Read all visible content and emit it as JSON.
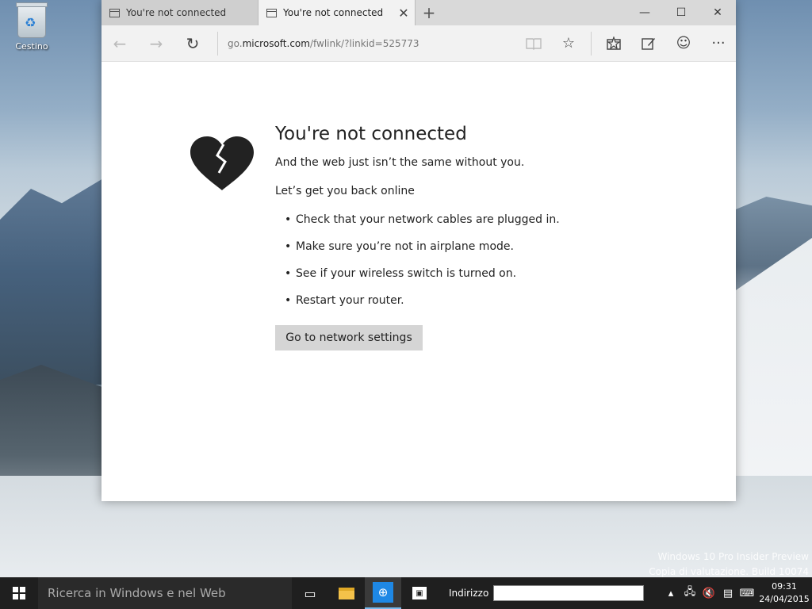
{
  "desktop": {
    "recycle_bin_label": "Cestino",
    "watermark_line1": "Windows 10 Pro Insider Preview",
    "watermark_line2": "Copia di valutazione. Build 10074"
  },
  "browser": {
    "tabs": [
      {
        "title": "You're not connected",
        "active": false
      },
      {
        "title": "You're not connected",
        "active": true
      }
    ],
    "new_tab_glyph": "+",
    "window_controls": {
      "minimize": "—",
      "maximize": "☐",
      "close": "✕"
    },
    "address": {
      "prefix": "go.",
      "host": "microsoft.com",
      "path": "/fwlink/?linkid=525773"
    }
  },
  "page": {
    "title": "You're not connected",
    "subtitle": "And the web just isn’t the same without you.",
    "prompt": "Let’s get you back online",
    "tips": [
      "Check that your network cables are plugged in.",
      "Make sure you’re not in airplane mode.",
      "See if your wireless switch is turned on.",
      "Restart your router."
    ],
    "button_label": "Go to network settings"
  },
  "taskbar": {
    "search_placeholder": "Ricerca in Windows e nel Web",
    "address_label": "Indirizzo",
    "address_value": "",
    "time": "09:31",
    "date": "24/04/2015"
  },
  "colors": {
    "taskbar_bg": "#1f1f1f",
    "edge_blue": "#1e88e5",
    "button_gray": "#d5d5d5",
    "heart": "#222222"
  }
}
